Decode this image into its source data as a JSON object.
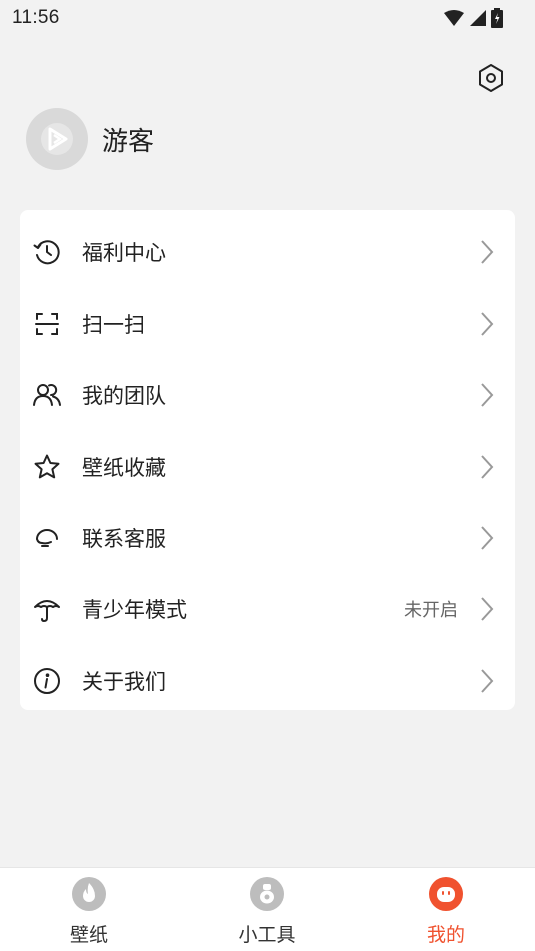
{
  "status_bar": {
    "time": "11:56"
  },
  "profile": {
    "username": "游客"
  },
  "menu": {
    "items": [
      {
        "label": "福利中心",
        "icon": "history-icon"
      },
      {
        "label": "扫一扫",
        "icon": "scan-icon"
      },
      {
        "label": "我的团队",
        "icon": "team-icon"
      },
      {
        "label": "壁纸收藏",
        "icon": "star-icon"
      },
      {
        "label": "联系客服",
        "icon": "headset-icon"
      },
      {
        "label": "青少年模式",
        "icon": "umbrella-icon",
        "value": "未开启"
      },
      {
        "label": "关于我们",
        "icon": "info-icon"
      }
    ]
  },
  "bottom_nav": {
    "items": [
      {
        "label": "壁纸",
        "icon": "flame-icon"
      },
      {
        "label": "小工具",
        "icon": "tool-icon"
      },
      {
        "label": "我的",
        "icon": "mine-icon",
        "active": true
      }
    ]
  },
  "colors": {
    "accent": "#f0522f",
    "background": "#f2f2f2",
    "card": "#ffffff",
    "inactive_icon": "#bdbdbd"
  }
}
